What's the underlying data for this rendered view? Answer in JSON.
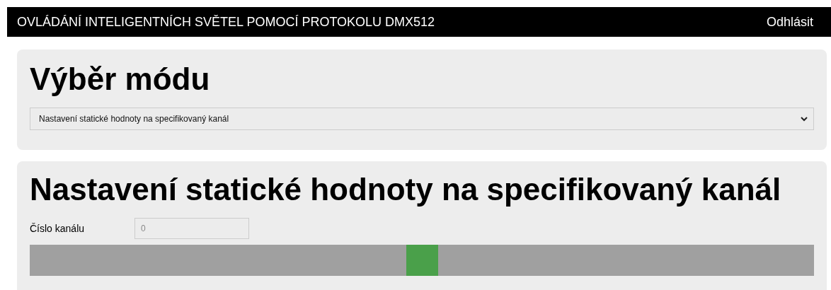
{
  "header": {
    "title": "OVLÁDÁNÍ INTELIGENTNÍCH SVĚTEL POMOCÍ PROTOKOLU DMX512",
    "logout": "Odhlásit"
  },
  "mode_panel": {
    "heading": "Výběr módu",
    "select_value": "Nastavení statické hodnoty na specifikovaný kanál"
  },
  "channel_panel": {
    "heading": "Nastavení statické hodnoty na specifikovaný kanál",
    "channel_label": "Číslo kanálu",
    "channel_placeholder": "0",
    "slider": {
      "level": 0.5
    }
  }
}
